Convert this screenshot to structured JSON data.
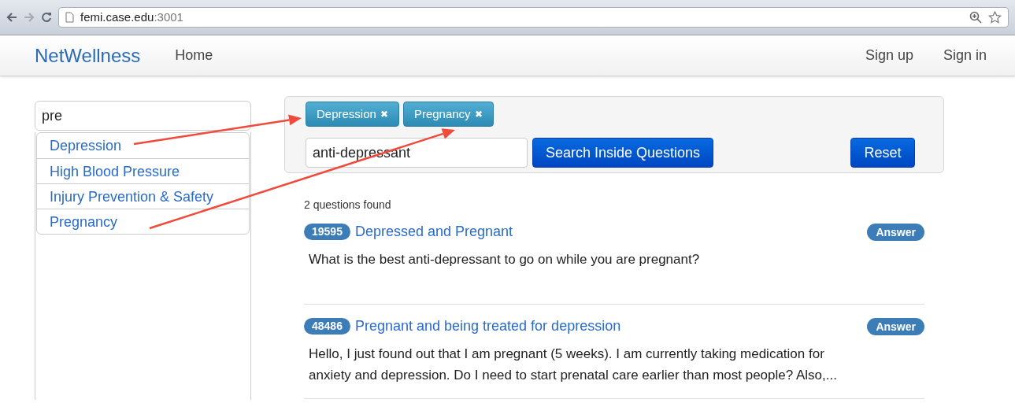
{
  "browser": {
    "address": {
      "host": "femi.case.edu",
      "port": ":3001"
    }
  },
  "navbar": {
    "brand": "NetWellness",
    "links": [
      "Home"
    ],
    "right_links": [
      "Sign up",
      "Sign in"
    ]
  },
  "topic_search": {
    "value": "pre",
    "suggestions": [
      "Depression",
      "High Blood Pressure",
      "Injury Prevention & Safety",
      "Pregnancy"
    ]
  },
  "filters": {
    "tags": [
      "Depression",
      "Pregnancy"
    ],
    "remove_glyph": "✖",
    "query": "anti-depressant",
    "search_button": "Search Inside Questions",
    "reset_button": "Reset"
  },
  "results": {
    "count": "2 questions found",
    "items": [
      {
        "id": "19595",
        "title": "Depressed and Pregnant",
        "badge": "Answer",
        "text": "What is the best anti-depressant to go on while you are pregnant?"
      },
      {
        "id": "48486",
        "title": "Pregnant and being treated for depression",
        "badge": "Answer",
        "text": "Hello, I just found out that I am pregnant (5 weeks). I am currently taking medication for anxiety and depression. Do I need to start prenatal care earlier than most people? Also,..."
      }
    ]
  }
}
